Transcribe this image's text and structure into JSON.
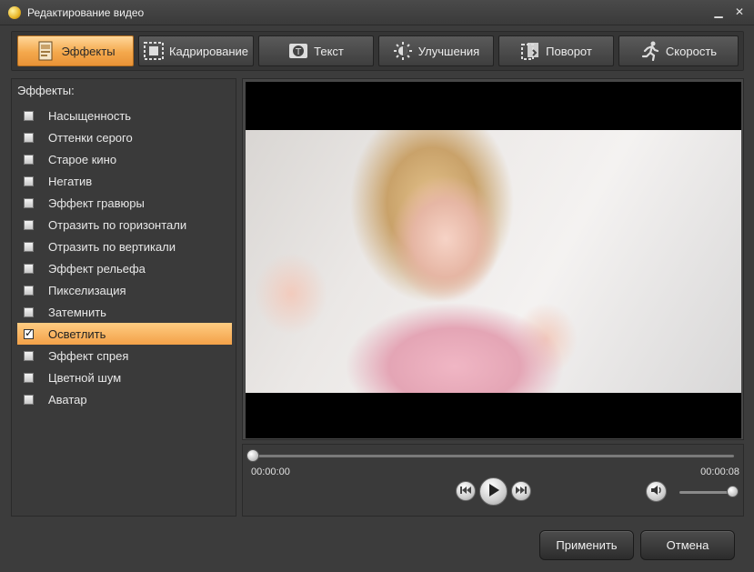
{
  "window": {
    "title": "Редактирование видео",
    "minimize_glyph": "▁",
    "close_glyph": "✕"
  },
  "tabs": [
    {
      "label": "Эффекты",
      "icon": "effects-icon",
      "active": true
    },
    {
      "label": "Кадрирование",
      "icon": "crop-icon",
      "active": false
    },
    {
      "label": "Текст",
      "icon": "text-icon",
      "active": false
    },
    {
      "label": "Улучшения",
      "icon": "brightness-icon",
      "active": false
    },
    {
      "label": "Поворот",
      "icon": "rotate-icon",
      "active": false
    },
    {
      "label": "Скорость",
      "icon": "speed-icon",
      "active": false
    }
  ],
  "effects_panel": {
    "title": "Эффекты:",
    "items": [
      {
        "label": "Насыщенность",
        "checked": false
      },
      {
        "label": "Оттенки серого",
        "checked": false
      },
      {
        "label": "Старое кино",
        "checked": false
      },
      {
        "label": "Негатив",
        "checked": false
      },
      {
        "label": "Эффект гравюры",
        "checked": false
      },
      {
        "label": "Отразить по горизонтали",
        "checked": false
      },
      {
        "label": "Отразить по вертикали",
        "checked": false
      },
      {
        "label": "Эффект рельефа",
        "checked": false
      },
      {
        "label": "Пикселизация",
        "checked": false
      },
      {
        "label": "Затемнить",
        "checked": false
      },
      {
        "label": "Осветлить",
        "checked": true
      },
      {
        "label": "Эффект спрея",
        "checked": false
      },
      {
        "label": "Цветной шум",
        "checked": false
      },
      {
        "label": "Аватар",
        "checked": false
      }
    ]
  },
  "player": {
    "current_time": "00:00:00",
    "total_time": "00:00:08",
    "progress": 0,
    "volume": 1.0
  },
  "buttons": {
    "apply": "Применить",
    "cancel": "Отмена"
  },
  "colors": {
    "accent": "#f4a84c",
    "background": "#3c3c3c"
  }
}
